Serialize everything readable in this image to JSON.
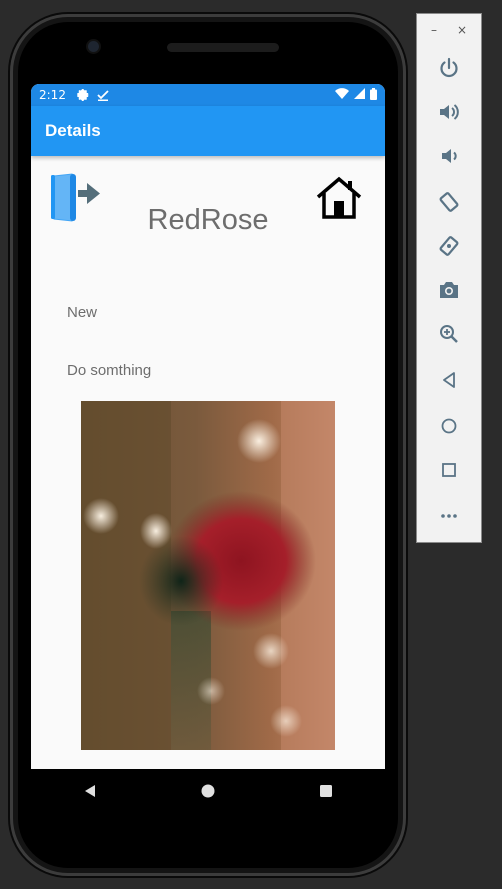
{
  "status_bar": {
    "time": "2:12"
  },
  "app_bar": {
    "title": "Details"
  },
  "details": {
    "name": "RedRose",
    "label_1": "New",
    "label_2": "Do somthing"
  },
  "icons": {
    "logout": "logout-door-arrow-icon",
    "home": "home-icon"
  },
  "emulator_toolbar": {
    "minimize": "–",
    "close": "×",
    "buttons": [
      "power",
      "volume-up",
      "volume-down",
      "rotate-left",
      "rotate-right",
      "screenshot",
      "zoom",
      "back",
      "home",
      "overview",
      "more"
    ]
  },
  "colors": {
    "status_bar": "#1e88e5",
    "app_bar": "#2196f3",
    "accent_blue": "#42a5f5",
    "text_gray": "#6d6d6d",
    "toolbar_icon": "#5a7486"
  }
}
